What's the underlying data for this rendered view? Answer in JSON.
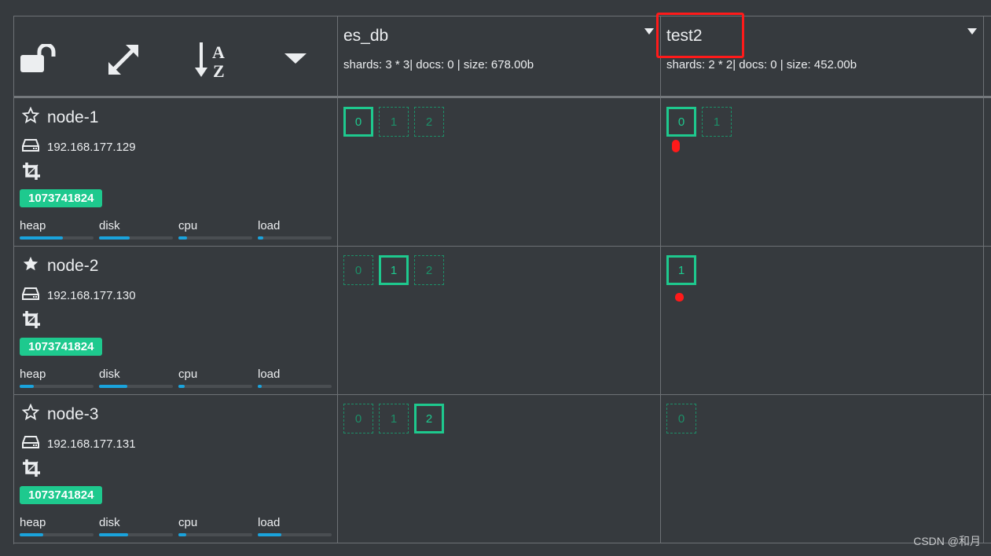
{
  "toolbar": {
    "icons": [
      "unlock-icon",
      "expand-icon",
      "sort-alpha-down-icon",
      "caret-down-icon"
    ]
  },
  "indices": [
    {
      "name": "es_db",
      "meta": "shards: 3 * 3| docs: 0 | size: 678.00b"
    },
    {
      "name": "test2",
      "meta": "shards: 2 * 2| docs: 0 | size: 452.00b"
    }
  ],
  "metric_labels": [
    "heap",
    "disk",
    "cpu",
    "load"
  ],
  "colors": {
    "primary_shard": "#1ec98e",
    "metric_bar": "#1aa3dc",
    "annotation": "#ff1a1a",
    "background": "#363a3e"
  },
  "nodes": [
    {
      "name": "node-1",
      "master": false,
      "ip": "192.168.177.129",
      "badge": "1073741824",
      "metrics": {
        "heap": 0.58,
        "disk": 0.42,
        "cpu": 0.12,
        "load": 0.07
      },
      "shards": [
        [
          {
            "n": "0",
            "state": "primary"
          },
          {
            "n": "1",
            "state": "replica"
          },
          {
            "n": "2",
            "state": "replica"
          }
        ],
        [
          {
            "n": "0",
            "state": "primary"
          },
          {
            "n": "1",
            "state": "replica"
          }
        ]
      ]
    },
    {
      "name": "node-2",
      "master": true,
      "ip": "192.168.177.130",
      "badge": "1073741824",
      "metrics": {
        "heap": 0.19,
        "disk": 0.38,
        "cpu": 0.08,
        "load": 0.05
      },
      "shards": [
        [
          {
            "n": "0",
            "state": "replica"
          },
          {
            "n": "1",
            "state": "primary"
          },
          {
            "n": "2",
            "state": "replica"
          }
        ],
        [
          {
            "n": "1",
            "state": "primary"
          }
        ]
      ]
    },
    {
      "name": "node-3",
      "master": false,
      "ip": "192.168.177.131",
      "badge": "1073741824",
      "metrics": {
        "heap": 0.32,
        "disk": 0.39,
        "cpu": 0.11,
        "load": 0.32
      },
      "shards": [
        [
          {
            "n": "0",
            "state": "replica"
          },
          {
            "n": "1",
            "state": "replica"
          },
          {
            "n": "2",
            "state": "primary"
          }
        ],
        [
          {
            "n": "0",
            "state": "replica"
          }
        ]
      ]
    }
  ],
  "watermark": "CSDN @和月"
}
